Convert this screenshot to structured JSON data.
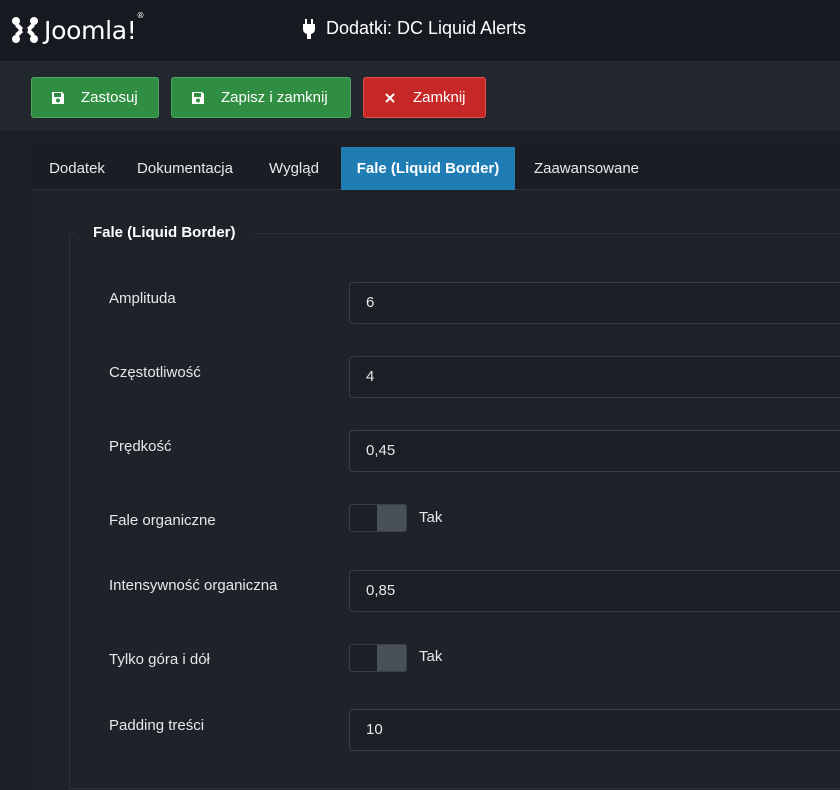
{
  "header": {
    "logo_text": "Joomla!",
    "logo_reg": "®",
    "title": "Dodatki: DC Liquid Alerts",
    "title_icon": "plug-icon"
  },
  "toolbar": {
    "apply_label": "Zastosuj",
    "save_close_label": "Zapisz i zamknij",
    "close_label": "Zamknij",
    "colors": {
      "success": "#2f8e42",
      "danger": "#c52827"
    }
  },
  "tabs": [
    {
      "label": "Dodatek",
      "active": false
    },
    {
      "label": "Dokumentacja",
      "active": false
    },
    {
      "label": "Wygląd",
      "active": false
    },
    {
      "label": "Fale (Liquid Border)",
      "active": true
    },
    {
      "label": "Zaawansowane",
      "active": false
    }
  ],
  "fieldset": {
    "legend": "Fale (Liquid Border)",
    "fields": {
      "amplitude": {
        "label": "Amplituda",
        "value": "6"
      },
      "frequency": {
        "label": "Częstotliwość",
        "value": "4"
      },
      "speed": {
        "label": "Prędkość",
        "value": "0,45"
      },
      "organic": {
        "label": "Fale organiczne",
        "value": "Tak"
      },
      "organic_intensity": {
        "label": "Intensywność organiczna",
        "value": "0,85"
      },
      "top_bottom_only": {
        "label": "Tylko góra i dół",
        "value": "Tak"
      },
      "padding": {
        "label": "Padding treści",
        "value": "10"
      }
    }
  },
  "accent_color": "#1f7db4"
}
